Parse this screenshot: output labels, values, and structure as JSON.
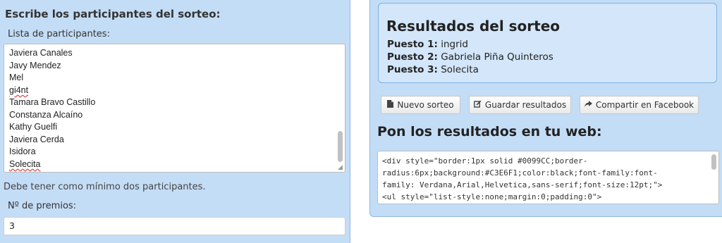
{
  "left": {
    "title": "Escribe los participantes del sorteo:",
    "list_label": "Lista de participantes:",
    "participants": [
      "Javiera Canales",
      "Javy Mendez",
      "Mel",
      "gi4nt",
      "Tamara Bravo Castillo",
      "Constanza Alcaíno",
      "Kathy Guelfi",
      "Javiera Cerda",
      "Isidora",
      "Solecita"
    ],
    "hint": "Debe tener como mínimo dos participantes.",
    "prizes_label": "Nº de premios:",
    "prizes_value": "3"
  },
  "results": {
    "title": "Resultados del sorteo",
    "places": [
      {
        "label": "Puesto 1:",
        "name": "ingrid"
      },
      {
        "label": "Puesto 2:",
        "name": "Gabriela Piña Quinteros"
      },
      {
        "label": "Puesto 3:",
        "name": "Solecita"
      }
    ]
  },
  "buttons": {
    "new_draw": "Nuevo sorteo",
    "save_results": "Guardar resultados",
    "share_facebook": "Compartir en Facebook"
  },
  "icons": {
    "new_draw": "document-icon",
    "save_results": "edit-icon",
    "share_facebook": "share-icon"
  },
  "web": {
    "title": "Pon los resultados en tu web:",
    "code_lines": [
      "<div style=\"border:1px solid #0099CC;border-",
      "radius:6px;background:#C3E6F1;color:black;font-family:font-",
      "family: Verdana,Arial,Helvetica,sans-serif;font-size:12pt;\">",
      "<ul style=\"list-style:none;margin:0;padding:0\">"
    ]
  },
  "colors": {
    "panel_bg": "#c4ddf6",
    "results_bg": "#d3e6fa",
    "results_border": "#7fb0e4"
  }
}
